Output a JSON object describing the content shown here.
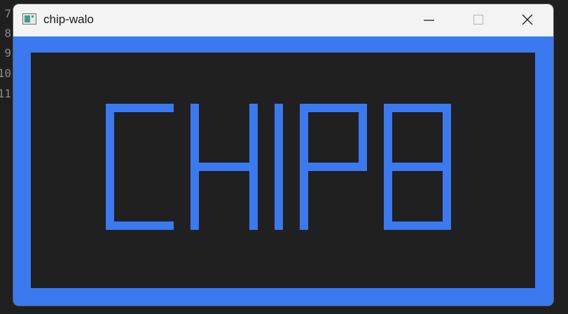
{
  "editor": {
    "line_numbers": [
      "7",
      "8",
      "9",
      "10",
      "11"
    ]
  },
  "window": {
    "title": "chip-walo",
    "icon": "app-window-icon",
    "controls": {
      "minimize_icon": "minimize-icon",
      "maximize_icon": "maximize-icon",
      "close_icon": "close-icon"
    }
  },
  "display": {
    "rendered_text": "CHIP8",
    "colors": {
      "foreground": "#3a79f0",
      "background": "#202020",
      "titlebar": "#f3f3f3"
    }
  }
}
